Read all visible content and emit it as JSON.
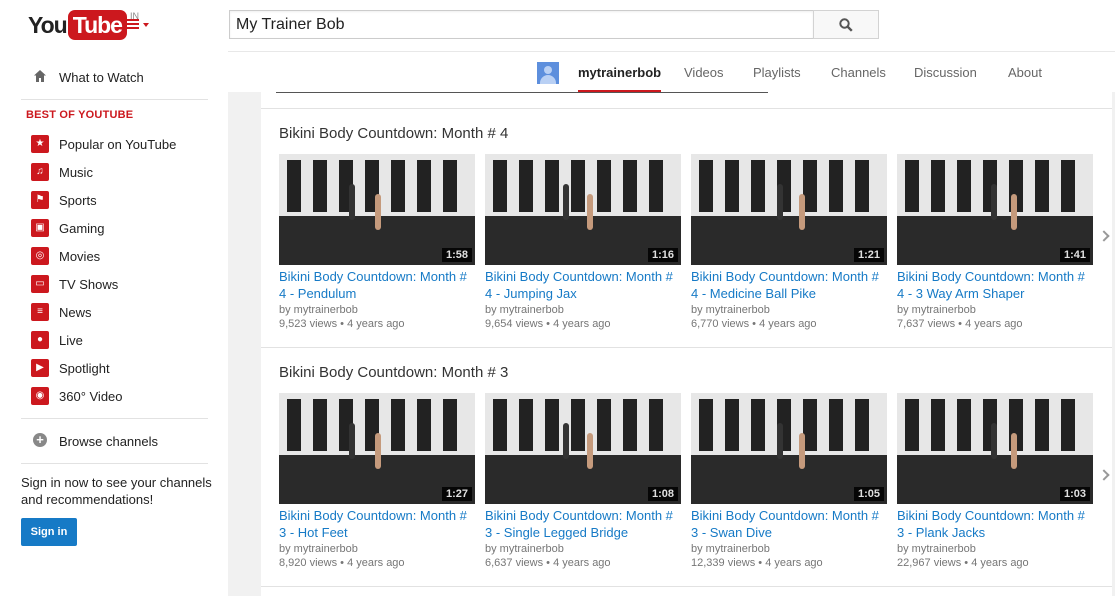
{
  "masthead": {
    "logo_you": "You",
    "logo_tube": "Tube",
    "logo_country": "IN",
    "search_value": "My Trainer Bob"
  },
  "guide": {
    "what_to_watch": "What to Watch",
    "best_heading": "BEST OF YOUTUBE",
    "items": [
      {
        "label": "Popular on YouTube",
        "icon": "popular-icon",
        "glyph": "★"
      },
      {
        "label": "Music",
        "icon": "music-icon",
        "glyph": "♫"
      },
      {
        "label": "Sports",
        "icon": "sports-icon",
        "glyph": "⚑"
      },
      {
        "label": "Gaming",
        "icon": "gaming-icon",
        "glyph": "▣"
      },
      {
        "label": "Movies",
        "icon": "movies-icon",
        "glyph": "◎"
      },
      {
        "label": "TV Shows",
        "icon": "tv-shows-icon",
        "glyph": "▭"
      },
      {
        "label": "News",
        "icon": "news-icon",
        "glyph": "≡"
      },
      {
        "label": "Live",
        "icon": "live-icon",
        "glyph": "●"
      },
      {
        "label": "Spotlight",
        "icon": "spotlight-icon",
        "glyph": "▶"
      },
      {
        "label": "360° Video",
        "icon": "360-video-icon",
        "glyph": "◉"
      }
    ],
    "browse_channels": "Browse channels",
    "signin_text": "Sign in now to see your channels and recommendations!",
    "signin_button": "Sign in"
  },
  "channel": {
    "tabs": [
      "mytrainerbob",
      "Videos",
      "Playlists",
      "Channels",
      "Discussion",
      "About"
    ],
    "active_tab": "mytrainerbob"
  },
  "sections": [
    {
      "title": "Bikini Body Countdown: Month # 4",
      "videos": [
        {
          "title": "Bikini Body Countdown: Month # 4 - Pendulum",
          "by": "by mytrainerbob",
          "views": "9,523 views",
          "age": "4 years ago",
          "duration": "1:58"
        },
        {
          "title": "Bikini Body Countdown: Month # 4 - Jumping Jax",
          "by": "by mytrainerbob",
          "views": "9,654 views",
          "age": "4 years ago",
          "duration": "1:16"
        },
        {
          "title": "Bikini Body Countdown: Month # 4 - Medicine Ball Pike",
          "by": "by mytrainerbob",
          "views": "6,770 views",
          "age": "4 years ago",
          "duration": "1:21"
        },
        {
          "title": "Bikini Body Countdown: Month # 4 - 3 Way Arm Shaper",
          "by": "by mytrainerbob",
          "views": "7,637 views",
          "age": "4 years ago",
          "duration": "1:41"
        }
      ]
    },
    {
      "title": "Bikini Body Countdown: Month # 3",
      "videos": [
        {
          "title": "Bikini Body Countdown: Month # 3 - Hot Feet",
          "by": "by mytrainerbob",
          "views": "8,920 views",
          "age": "4 years ago",
          "duration": "1:27"
        },
        {
          "title": "Bikini Body Countdown: Month # 3 - Single Legged Bridge",
          "by": "by mytrainerbob",
          "views": "6,637 views",
          "age": "4 years ago",
          "duration": "1:08"
        },
        {
          "title": "Bikini Body Countdown: Month # 3 - Swan Dive",
          "by": "by mytrainerbob",
          "views": "12,339 views",
          "age": "4 years ago",
          "duration": "1:05"
        },
        {
          "title": "Bikini Body Countdown: Month # 3 - Plank Jacks",
          "by": "by mytrainerbob",
          "views": "22,967 views",
          "age": "4 years ago",
          "duration": "1:03"
        }
      ]
    }
  ],
  "colors": {
    "brand_red": "#cc181e",
    "link_blue": "#167ac6",
    "meta_gray": "#767676"
  }
}
